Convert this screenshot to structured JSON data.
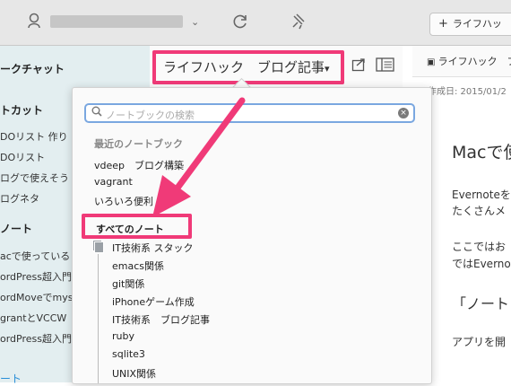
{
  "toolbar": {
    "new_note_label": "ライフハッ"
  },
  "sidebar": {
    "work_chat": "ークチャット",
    "shortcuts": "トカット",
    "shortcut_items": [
      "DOリスト 作り",
      "DOリスト",
      "ログで使えそう",
      "ログネタ"
    ],
    "notes_heading": "ノート",
    "note_items": [
      "acで使っている",
      "ordPress超入門",
      "ordMoveでmys",
      "grantとVCCW",
      "ordPress超入門"
    ],
    "bottom_link": "ート"
  },
  "header": {
    "notebook_title": "ライフハック　ブログ記事",
    "notebook_caret": "▾"
  },
  "right": {
    "notebook_crumb": "ライフハック　ブ",
    "created": "作成日: 2015/01/2",
    "note_title": "Macで使",
    "body1": "Evernoteを",
    "body2": "たくさんメ",
    "body3": "ここではお",
    "body4": "ではEverno",
    "heading2": "「ノート",
    "body5": "アプリを開"
  },
  "dropdown": {
    "search_placeholder": "ノートブックの検索",
    "recent_label": "最近のノートブック",
    "recent_items": [
      "vdeep　ブログ構築",
      "vagrant",
      "いろいろ便利"
    ],
    "all_notes_label": "すべてのノート",
    "stack_name": "IT技術系 スタック",
    "stack_items": [
      "emacs関係",
      "git関係",
      "iPhoneゲーム作成",
      "IT技術系　ブログ記事",
      "ruby",
      "sqlite3",
      "UNIX関係"
    ]
  },
  "colors": {
    "highlight": "#f03a78",
    "sidebar_bg": "#e3eef0"
  }
}
